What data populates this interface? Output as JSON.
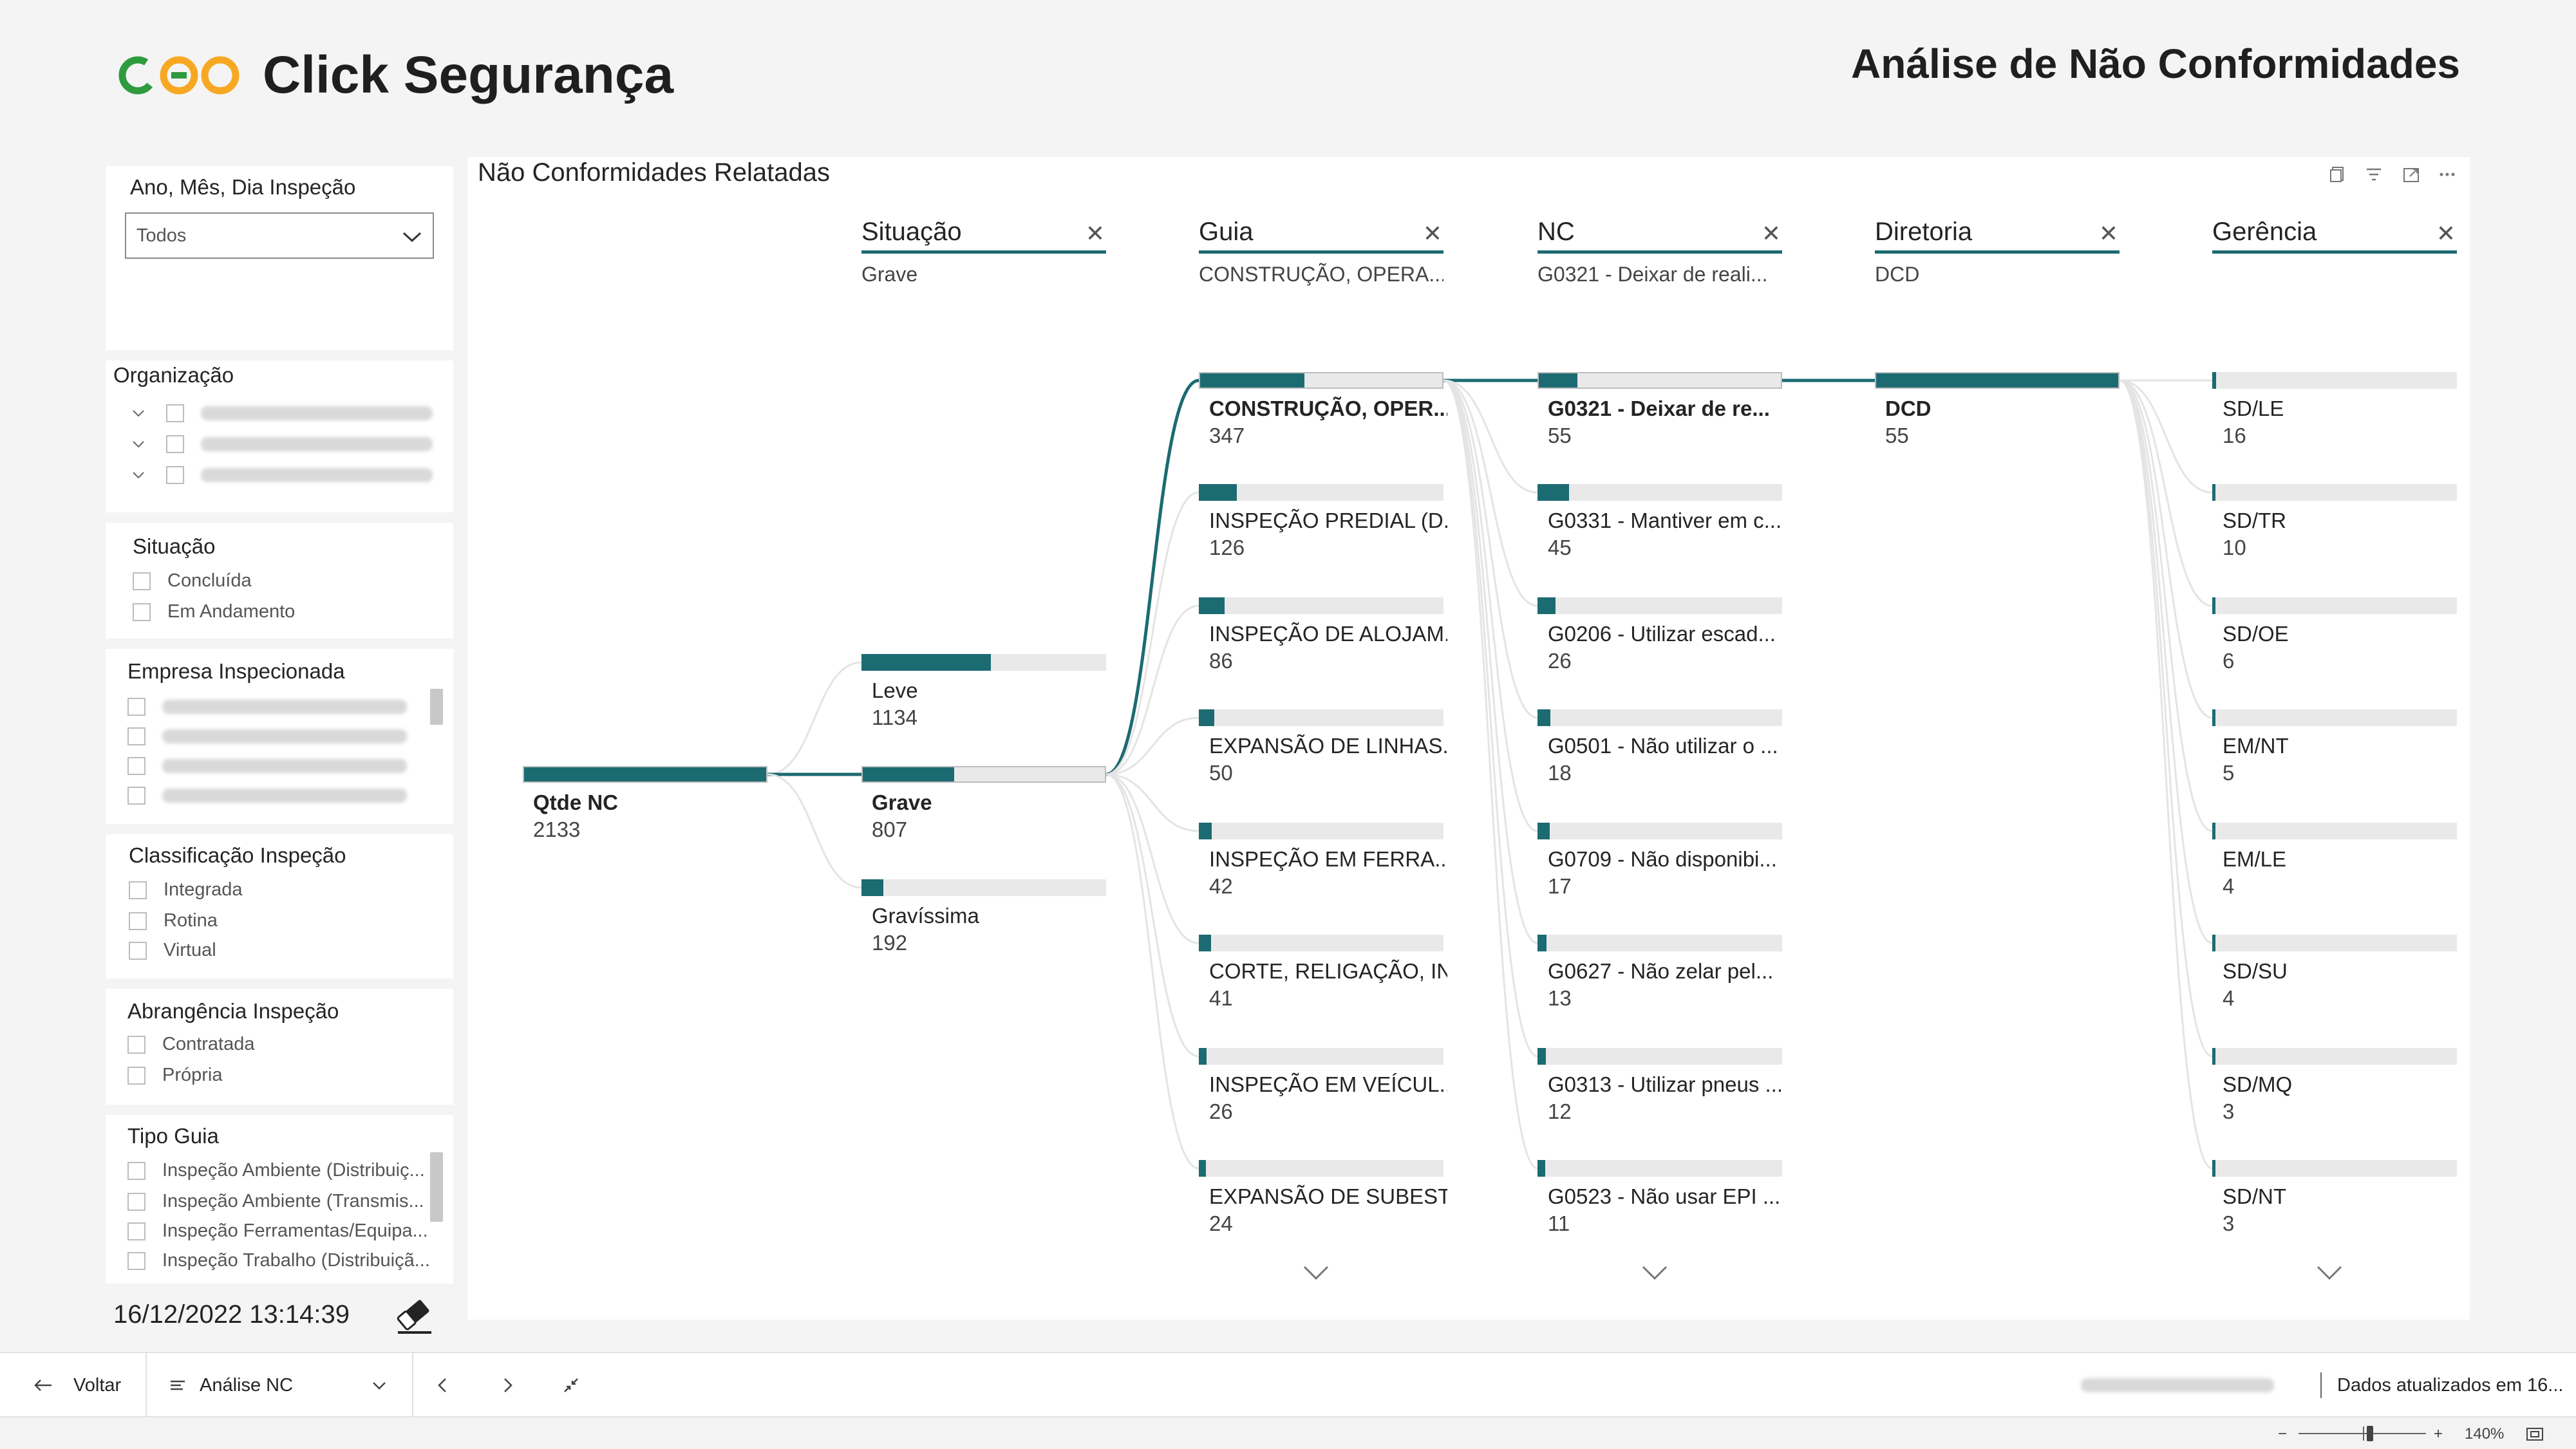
{
  "header": {
    "logo_text": "Click Segurança",
    "report_title": "Análise de Não Conformidades",
    "brand_colors": {
      "orange": "#f7a823",
      "green": "#2e9b3e"
    }
  },
  "slicers": {
    "date": {
      "title": "Ano, Mês, Dia Inspeção",
      "value": "Todos"
    },
    "organizacao": {
      "title": "Organização"
    },
    "situacao": {
      "title": "Situação",
      "options": [
        "Concluída",
        "Em Andamento"
      ]
    },
    "empresa": {
      "title": "Empresa Inspecionada"
    },
    "classificacao": {
      "title": "Classificação Inspeção",
      "options": [
        "Integrada",
        "Rotina",
        "Virtual"
      ]
    },
    "abrangencia": {
      "title": "Abrangência Inspeção",
      "options": [
        "Contratada",
        "Própria"
      ]
    },
    "tipo_guia": {
      "title": "Tipo Guia",
      "options": [
        "Inspeção Ambiente (Distribuiç...",
        "Inspeção Ambiente (Transmis...",
        "Inspeção Ferramentas/Equipa...",
        "Inspeção Trabalho (Distribuiçã..."
      ]
    }
  },
  "timestamp": "16/12/2022 13:14:39",
  "visual": {
    "title": "Não Conformidades Relatadas",
    "accent": "#1c6b72",
    "levels": [
      {
        "name": "Situação",
        "value": "Grave"
      },
      {
        "name": "Guia",
        "value": "CONSTRUÇÃO, OPERA..."
      },
      {
        "name": "NC",
        "value": "G0321 - Deixar de reali..."
      },
      {
        "name": "Diretoria",
        "value": "DCD"
      },
      {
        "name": "Gerência",
        "value": ""
      }
    ],
    "root": {
      "label": "Qtde NC",
      "value": "2133"
    },
    "situacao": [
      {
        "label": "Leve",
        "value": "1134",
        "frac": 0.53
      },
      {
        "label": "Grave",
        "value": "807",
        "frac": 0.378
      },
      {
        "label": "Gravíssima",
        "value": "192",
        "frac": 0.09
      }
    ],
    "guia": [
      {
        "label": "CONSTRUÇÃO, OPER...",
        "value": "347"
      },
      {
        "label": "INSPEÇÃO PREDIAL (D...",
        "value": "126"
      },
      {
        "label": "INSPEÇÃO DE ALOJAM...",
        "value": "86"
      },
      {
        "label": "EXPANSÃO DE LINHAS...",
        "value": "50"
      },
      {
        "label": "INSPEÇÃO EM FERRA...",
        "value": "42"
      },
      {
        "label": "CORTE, RELIGAÇÃO, IN...",
        "value": "41"
      },
      {
        "label": "INSPEÇÃO EM VEÍCUL...",
        "value": "26"
      },
      {
        "label": "EXPANSÃO DE SUBEST...",
        "value": "24"
      }
    ],
    "nc": [
      {
        "label": "G0321 - Deixar de re...",
        "value": "55"
      },
      {
        "label": "G0331 - Mantiver em c...",
        "value": "45"
      },
      {
        "label": "G0206 - Utilizar escad...",
        "value": "26"
      },
      {
        "label": "G0501 - Não utilizar o ...",
        "value": "18"
      },
      {
        "label": "G0709 - Não disponibi...",
        "value": "17"
      },
      {
        "label": "G0627 - Não zelar pel...",
        "value": "13"
      },
      {
        "label": "G0313 - Utilizar pneus ...",
        "value": "12"
      },
      {
        "label": "G0523 - Não usar EPI ...",
        "value": "11"
      }
    ],
    "diretoria": [
      {
        "label": "DCD",
        "value": "55"
      }
    ],
    "gerencia": [
      {
        "label": "SD/LE",
        "value": "16"
      },
      {
        "label": "SD/TR",
        "value": "10"
      },
      {
        "label": "SD/OE",
        "value": "6"
      },
      {
        "label": "EM/NT",
        "value": "5"
      },
      {
        "label": "EM/LE",
        "value": "4"
      },
      {
        "label": "SD/SU",
        "value": "4"
      },
      {
        "label": "SD/MQ",
        "value": "3"
      },
      {
        "label": "SD/NT",
        "value": "3"
      }
    ]
  },
  "pagebar": {
    "back_label": "Voltar",
    "page_label": "Análise NC",
    "data_updated": "Dados atualizados em 16...",
    "zoom": "140%"
  }
}
